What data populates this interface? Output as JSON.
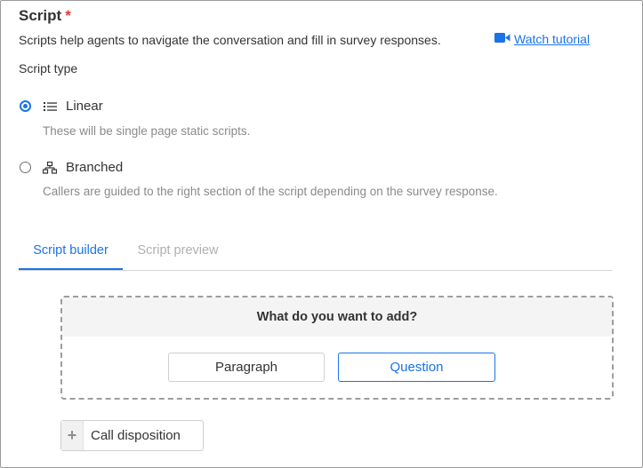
{
  "section": {
    "title": "Script",
    "required_marker": "*",
    "description": "Scripts help agents to navigate the conversation and fill in survey responses.",
    "watch_tutorial": "Watch tutorial"
  },
  "script_type": {
    "label": "Script type",
    "selected": "Linear",
    "options": [
      {
        "label": "Linear",
        "description": "These will be single page static scripts.",
        "icon": "list-icon",
        "checked": true
      },
      {
        "label": "Branched",
        "description": "Callers are guided to the right section of the script depending on the survey response.",
        "icon": "sitemap-icon",
        "checked": false
      }
    ]
  },
  "tabs": [
    {
      "label": "Script builder",
      "active": true
    },
    {
      "label": "Script preview",
      "active": false
    }
  ],
  "add_panel": {
    "heading": "What do you want to add?",
    "paragraph_button": "Paragraph",
    "question_button": "Question"
  },
  "call_disposition": {
    "icon": "plus-icon",
    "label": "Call disposition"
  },
  "colors": {
    "accent": "#1a73e8",
    "required": "#e53935",
    "muted_text": "#8a8a8a"
  }
}
